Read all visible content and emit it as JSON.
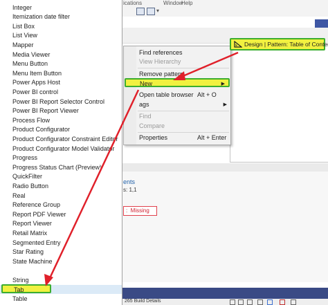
{
  "background": {
    "menu_fragments": [
      "ications",
      "Window",
      "Help"
    ],
    "fragments": {
      "ents": "ents",
      "count": "s: 1,1",
      "missing": "Missing",
      "status": "265 Build Details"
    }
  },
  "list": {
    "items": [
      "Integer",
      "Itemization date filter",
      "List Box",
      "List View",
      "Mapper",
      "Media Viewer",
      "Menu Button",
      "Menu Item Button",
      "Power Apps Host",
      "Power BI control",
      "Power BI Report Selector Control",
      "Power BI Report Viewer",
      "Process Flow",
      "Product Configurator",
      "Product Configurator Constraint Editor",
      "Product Configurator Model Validator",
      "Progress",
      "Progress Status Chart (Preview)",
      "QuickFilter",
      "Radio Button",
      "Real",
      "Reference Group",
      "Report PDF Viewer",
      "Report Viewer",
      "Retail Matrix",
      "Segmented Entry",
      "Star Rating",
      "State Machine",
      "String",
      "Tab",
      "Table"
    ]
  },
  "context_menu": {
    "find_references": "Find references",
    "view_hierarchy": "View Hierarchy",
    "remove_pattern": "Remove pattern",
    "new": "New",
    "open_table_browser": "Open table browser",
    "open_table_browser_shortcut": "Alt + O",
    "tags": "ags",
    "find": "Find",
    "compare": "Compare",
    "properties": "Properties",
    "properties_shortcut": "Alt + Enter"
  },
  "callout": {
    "text": "Design | Pattern: Table of Contents"
  },
  "colors": {
    "highlight_fill": "#f1f140",
    "highlight_border": "#3cad2e",
    "arrow": "#e0202a"
  }
}
